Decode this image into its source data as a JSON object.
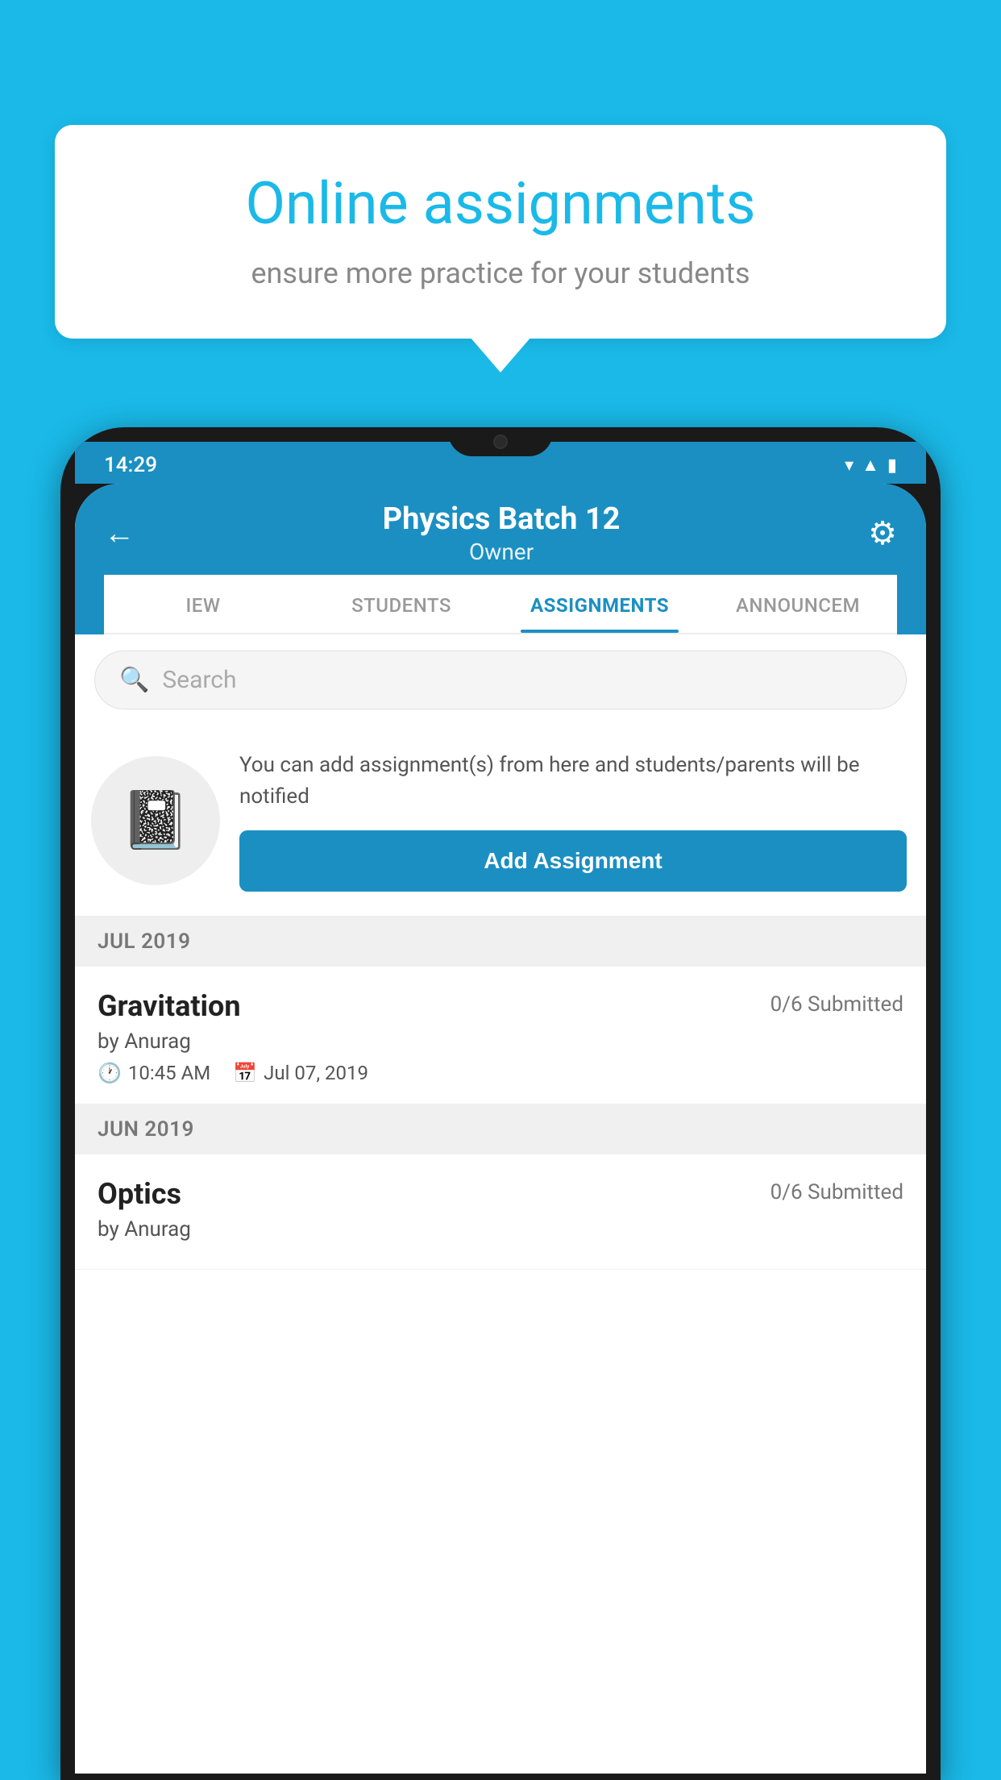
{
  "background_color": "#1ab9e8",
  "speech_bubble": {
    "title": "Online assignments",
    "subtitle": "ensure more practice for your students"
  },
  "status_bar": {
    "time": "14:29",
    "wifi_icon": "▼",
    "signal_icon": "▲",
    "battery_icon": "▮"
  },
  "header": {
    "title": "Physics Batch 12",
    "subtitle": "Owner",
    "back_label": "←",
    "settings_label": "⚙"
  },
  "tabs": [
    {
      "label": "IEW",
      "active": false
    },
    {
      "label": "STUDENTS",
      "active": false
    },
    {
      "label": "ASSIGNMENTS",
      "active": true
    },
    {
      "label": "ANNOUNCEM",
      "active": false
    }
  ],
  "search": {
    "placeholder": "Search"
  },
  "promo": {
    "description_text": "You can add assignment(s) from here and students/parents will be notified",
    "button_label": "Add Assignment"
  },
  "sections": [
    {
      "month_label": "JUL 2019",
      "assignments": [
        {
          "name": "Gravitation",
          "submitted": "0/6 Submitted",
          "by": "by Anurag",
          "time": "10:45 AM",
          "date": "Jul 07, 2019"
        }
      ]
    },
    {
      "month_label": "JUN 2019",
      "assignments": [
        {
          "name": "Optics",
          "submitted": "0/6 Submitted",
          "by": "by Anurag",
          "time": "",
          "date": ""
        }
      ]
    }
  ]
}
